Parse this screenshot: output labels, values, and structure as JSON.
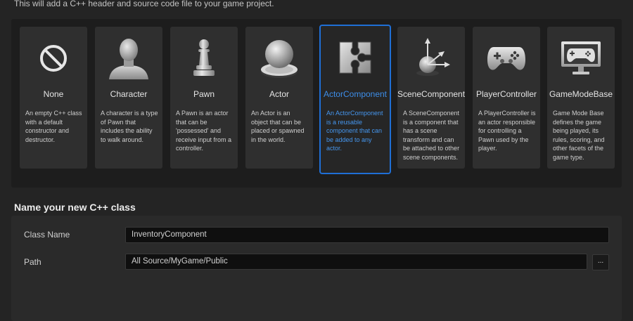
{
  "header": {
    "intro": "This will add a C++ header and source code file to your game project."
  },
  "cards": [
    {
      "id": "none",
      "title": "None",
      "desc": "An empty C++ class with a default constructor and destructor.",
      "icon": "no-symbol-icon"
    },
    {
      "id": "character",
      "title": "Character",
      "desc": "A character is a type of Pawn that includes the ability to walk around.",
      "icon": "character-bust-icon"
    },
    {
      "id": "pawn",
      "title": "Pawn",
      "desc": "A Pawn is an actor that can be 'possessed' and receive input from a controller.",
      "icon": "chess-pawn-icon"
    },
    {
      "id": "actor",
      "title": "Actor",
      "desc": "An Actor is an object that can be placed or spawned in the world.",
      "icon": "sphere-on-base-icon"
    },
    {
      "id": "actorcomponent",
      "title": "ActorComponent",
      "desc": "An ActorComponent is a reusable component that can be added to any actor.",
      "icon": "puzzle-piece-icon",
      "selected": true
    },
    {
      "id": "scenecomponent",
      "title": "SceneComponent",
      "desc": "A SceneComponent is a component that has a scene transform and can be attached to other scene components.",
      "icon": "sphere-transform-axes-icon"
    },
    {
      "id": "playercontroller",
      "title": "PlayerController",
      "desc": "A PlayerController is an actor responsible for controlling a Pawn used by the player.",
      "icon": "gamepad-icon"
    },
    {
      "id": "gamemodebase",
      "title": "GameModeBase",
      "desc": "Game Mode Base defines the game being played, its rules, scoring, and other facets of the game type.",
      "icon": "gamepad-monitor-icon"
    }
  ],
  "form": {
    "section_title": "Name your new C++ class",
    "class_name_label": "Class Name",
    "class_name_value": "InventoryComponent",
    "path_label": "Path",
    "path_value": "All Source/MyGame/Public",
    "browse_label": "..."
  },
  "colors": {
    "accent": "#1f6fd6",
    "selected_text": "#3d8de8",
    "background": "#242424",
    "panel": "#1d1d1d",
    "card": "#2f2f2f"
  }
}
